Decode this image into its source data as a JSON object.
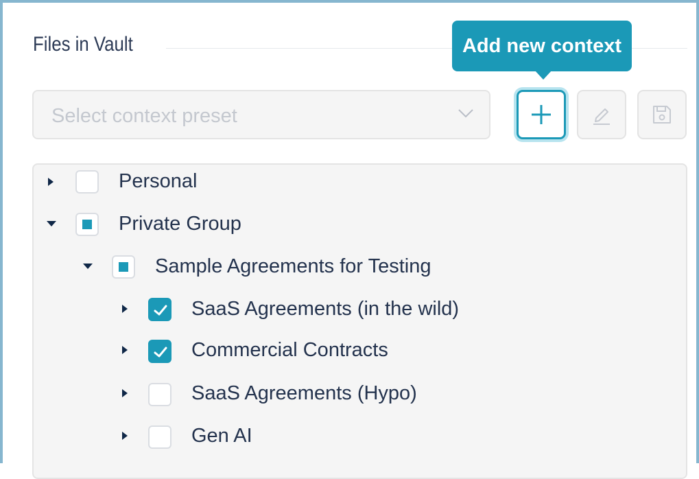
{
  "header": {
    "title": "Files in Vault"
  },
  "tooltip": {
    "text": "Add new context"
  },
  "preset_select": {
    "placeholder": "Select context preset"
  },
  "toolbar": {
    "buttons": [
      {
        "name": "add",
        "icon": "plus-icon"
      },
      {
        "name": "edit",
        "icon": "pencil-icon"
      },
      {
        "name": "save",
        "icon": "floppy-disk-icon"
      }
    ]
  },
  "tree": {
    "items": [
      {
        "label": "Personal",
        "expanded": false,
        "check": "unchecked",
        "level": 0
      },
      {
        "label": "Private Group",
        "expanded": true,
        "check": "partial",
        "level": 0
      },
      {
        "label": "Sample Agreements for Testing",
        "expanded": true,
        "check": "partial",
        "level": 1
      },
      {
        "label": "SaaS Agreements (in the wild)",
        "expanded": false,
        "check": "checked",
        "level": 2
      },
      {
        "label": "Commercial Contracts",
        "expanded": false,
        "check": "checked",
        "level": 2
      },
      {
        "label": "SaaS Agreements (Hypo)",
        "expanded": false,
        "check": "unchecked",
        "level": 2
      },
      {
        "label": "Gen AI",
        "expanded": false,
        "check": "unchecked",
        "level": 2
      }
    ]
  },
  "colors": {
    "accent": "#1b99b7",
    "text": "#23324d",
    "frame": "#86b6cf"
  }
}
